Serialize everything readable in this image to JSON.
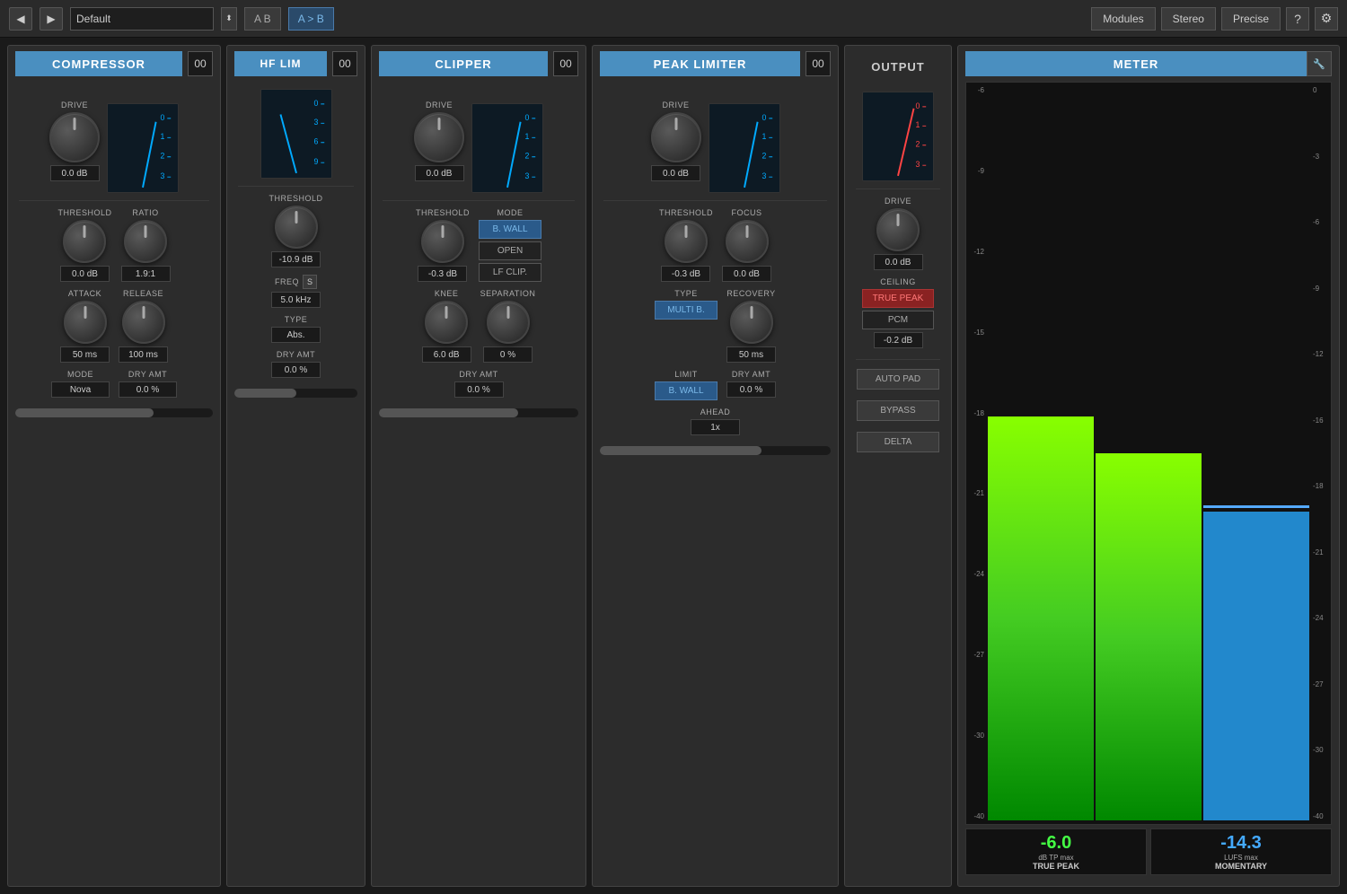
{
  "topBar": {
    "backLabel": "◀",
    "forwardLabel": "▶",
    "presetValue": "Default",
    "abLabel": "A B",
    "abActiveLabel": "A > B",
    "modulesLabel": "Modules",
    "stereoLabel": "Stereo",
    "preciseLabel": "Precise",
    "helpLabel": "?",
    "settingsLabel": "⚙"
  },
  "compressor": {
    "title": "COMPRESSOR",
    "num": "00",
    "driveLabel": "DRIVE",
    "driveValue": "0.0 dB",
    "thresholdLabel": "THRESHOLD",
    "thresholdValue": "0.0 dB",
    "ratioLabel": "RATIO",
    "ratioValue": "1.9:1",
    "attackLabel": "ATTACK",
    "attackValue": "50 ms",
    "releaseLabel": "RELEASE",
    "releaseValue": "100 ms",
    "modeLabel": "MODE",
    "modeValue": "Nova",
    "dryAmtLabel": "DRY AMT",
    "dryAmtValue": "0.0 %",
    "needleNumbers": [
      "0",
      "1",
      "2",
      "3"
    ]
  },
  "hfLim": {
    "title": "HF LIM",
    "num": "00",
    "thresholdLabel": "THRESHOLD",
    "thresholdValue": "-10.9 dB",
    "freqLabel": "FREQ",
    "freqValue": "5.0 kHz",
    "typeLabel": "TYPE",
    "typeValue": "Abs.",
    "dryAmtLabel": "DRY AMT",
    "dryAmtValue": "0.0 %",
    "needleNumbers": [
      "0",
      "3",
      "6",
      "9"
    ]
  },
  "clipper": {
    "title": "CLIPPER",
    "num": "00",
    "driveLabel": "DRIVE",
    "driveValue": "0.0 dB",
    "thresholdLabel": "THRESHOLD",
    "thresholdValue": "-0.3 dB",
    "modeLabel": "MODE",
    "modeBtnBwall": "B. WALL",
    "modeBtnOpen": "OPEN",
    "modeBtnLfClip": "LF CLIP.",
    "kneeLabel": "KNEE",
    "kneeValue": "6.0 dB",
    "separationLabel": "SEPARATION",
    "separationValue": "0 %",
    "dryAmtLabel": "DRY AMT",
    "dryAmtValue": "0.0 %",
    "needleNumbers": [
      "0",
      "1",
      "2",
      "3"
    ]
  },
  "peakLimiter": {
    "title": "PEAK LIMITER",
    "num": "00",
    "driveLabel": "DRIVE",
    "driveValue": "0.0 dB",
    "thresholdLabel": "THRESHOLD",
    "thresholdValue": "-0.3 dB",
    "focusLabel": "FOCUS",
    "focusValue": "0.0 dB",
    "typeLabel": "TYPE",
    "typeBtnMultiB": "MULTI B.",
    "limitLabel": "LIMIT",
    "limitBtnBwall": "B. WALL",
    "recoveryLabel": "RECOVERY",
    "recoveryValue": "50 ms",
    "aheadLabel": "AHEAD",
    "aheadValue": "1x",
    "dryAmtLabel": "DRY AMT",
    "dryAmtValue": "0.0 %",
    "needleNumbers": [
      "0",
      "1",
      "2",
      "3"
    ]
  },
  "output": {
    "title": "OUTPUT",
    "driveLabel": "DRIVE",
    "driveValue": "0.0 dB",
    "ceilingLabel": "CEILING",
    "ceilingBtnTruePeak": "TRUE PEAK",
    "ceilingBtnPcm": "PCM",
    "ceilingValue": "-0.2 dB",
    "autoPadLabel": "AUTO PAD",
    "bypassLabel": "BYPASS",
    "deltaLabel": "DELTA",
    "needleNumbers": [
      "0",
      "1",
      "2",
      "3"
    ]
  },
  "meter": {
    "title": "METER",
    "wrenchLabel": "🔧",
    "scaleLabels": [
      "0",
      "-3",
      "-6",
      "-9",
      "-12",
      "-16",
      "-18",
      "-21",
      "-24",
      "-27",
      "-30",
      "-40"
    ],
    "leftScaleLabels": [
      "-6",
      "-9",
      "-12",
      "-15",
      "-18",
      "-21",
      "-24",
      "-27",
      "-30",
      "-40"
    ],
    "greenBar1Height": "55",
    "greenBar2Height": "50",
    "blueBarHeight": "40",
    "truePeakValue": "-6.0",
    "truePeakLabel1": "dB TP max",
    "truePeakLabel2": "TRUE PEAK",
    "lufsValue": "-14.3",
    "lufsLabel1": "LUFS max",
    "lufsLabel2": "MOMENTARY"
  }
}
